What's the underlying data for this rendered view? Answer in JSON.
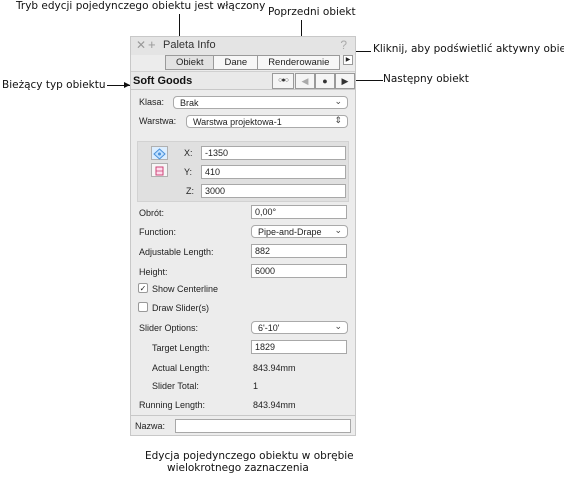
{
  "callouts": {
    "single_edit": "Tryb edycji pojedynczego obiektu jest włączony",
    "previous": "Poprzedni obiekt",
    "highlight": "Kliknij, aby podświetlić aktywny obiekt.",
    "current_type": "Bieżący typ obiektu",
    "next": "Następny obiekt",
    "caption_line1": "Edycja pojedynczego obiektu w obrębie",
    "caption_line2": "wielokrotnego zaznaczenia"
  },
  "palette": {
    "title": "Paleta Info",
    "help": "?",
    "tabs": [
      "Obiekt",
      "Dane",
      "Renderowanie"
    ],
    "object_type": "Soft Goods",
    "nav": {
      "single_mode": "○●○",
      "prev": "◀",
      "highlight": "●",
      "next": "▶"
    },
    "class_label": "Klasa:",
    "class_value": "Brak",
    "layer_label": "Warstwa:",
    "layer_value": "Warstwa projektowa-1",
    "x_label": "X:",
    "x_value": "-1350",
    "y_label": "Y:",
    "y_value": "410",
    "z_label": "Z:",
    "z_value": "3000",
    "rotation_label": "Obrót:",
    "rotation_value": "0,00°",
    "function_label": "Function:",
    "function_value": "Pipe-and-Drape",
    "adj_length_label": "Adjustable Length:",
    "adj_length_value": "882",
    "height_label": "Height:",
    "height_value": "6000",
    "show_centerline_label": "Show Centerline",
    "show_centerline_checked": true,
    "draw_sliders_label": "Draw Slider(s)",
    "draw_sliders_checked": false,
    "slider_options_label": "Slider Options:",
    "slider_options_value": "6'-10'",
    "target_length_label": "Target Length:",
    "target_length_value": "1829",
    "actual_length_label": "Actual Length:",
    "actual_length_value": "843.94mm",
    "slider_total_label": "Slider Total:",
    "slider_total_value": "1",
    "running_length_label": "Running Length:",
    "running_length_value": "843.94mm",
    "name_label": "Nazwa:",
    "name_value": ""
  }
}
